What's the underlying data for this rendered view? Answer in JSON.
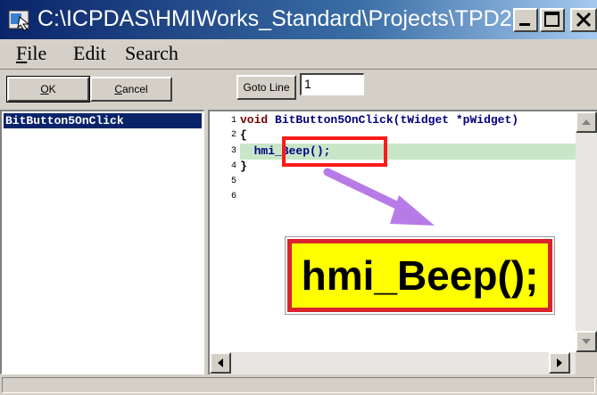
{
  "window": {
    "title": "C:\\ICPDAS\\HMIWorks_Standard\\Projects\\TPD2..."
  },
  "menu": {
    "file": {
      "first": "F",
      "rest": "ile"
    },
    "edit": "Edit",
    "search": "Search"
  },
  "toolbar": {
    "ok": {
      "first": "O",
      "rest": "K"
    },
    "cancel": {
      "first": "C",
      "rest": "ancel"
    },
    "goto_line": "Goto Line",
    "line_value": "1"
  },
  "function_list": [
    "BitButton5OnClick"
  ],
  "editor": {
    "line_numbers": [
      "1",
      "2",
      "3",
      "4",
      "5",
      "6"
    ],
    "lines": [
      {
        "keyword": "void ",
        "text": "BitButton5OnClick(",
        "type": "tWidget",
        "tail": " *pWidget)"
      },
      {
        "text": "{"
      },
      {
        "text": "  hmi_Beep();"
      },
      {
        "text": "}"
      }
    ],
    "callout_text": "hmi_Beep();"
  },
  "colors": {
    "title_gradient_start": "#0a246a",
    "selection": "#0a246a",
    "callout_fill": "#ffff00",
    "callout_border": "#d9232d",
    "arrow": "#b77be8",
    "highlight_row": "#c8e6c8"
  }
}
